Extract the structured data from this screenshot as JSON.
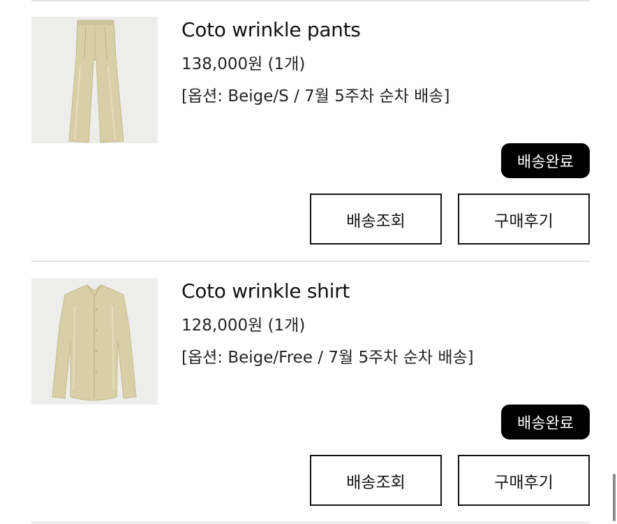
{
  "orders": [
    {
      "product_name": "Coto wrinkle pants",
      "price": "138,000원 (1개)",
      "option": "[옵션: Beige/S / 7월 5주차 순차 배송]",
      "status": "배송완료",
      "track_label": "배송조회",
      "review_label": "구매후기",
      "image": "beige-wide-pants"
    },
    {
      "product_name": "Coto wrinkle shirt",
      "price": "128,000원 (1개)",
      "option": "[옵션: Beige/Free / 7월 5주차 순차 배송]",
      "status": "배송완료",
      "track_label": "배송조회",
      "review_label": "구매후기",
      "image": "beige-long-sleeve-shirt"
    }
  ],
  "colors": {
    "badge_bg": "#000000",
    "garment_beige": "#d8cfa6",
    "divider": "#e3e3e3"
  }
}
